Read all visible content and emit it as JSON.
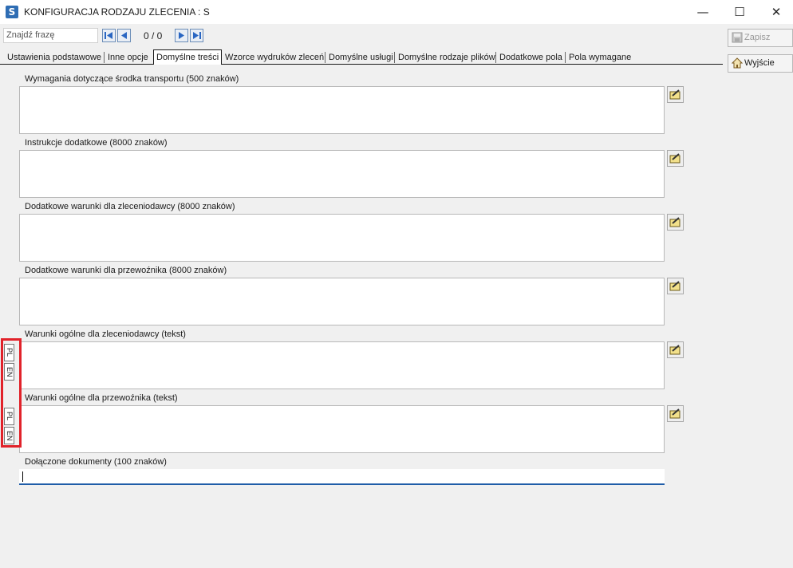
{
  "window": {
    "title": "KONFIGURACJA RODZAJU ZLECENIA : S",
    "app_icon_letter": "S",
    "minimize": "—",
    "maximize": "☐",
    "close": "✕"
  },
  "search": {
    "placeholder": "Znajdź frazę",
    "counter": "0 / 0"
  },
  "actions": {
    "save_label": "Zapisz",
    "exit_label": "Wyjście"
  },
  "tabs": [
    {
      "label": "Ustawienia podstawowe"
    },
    {
      "label": "Inne opcje"
    },
    {
      "label": "Domyślne treści"
    },
    {
      "label": "Wzorce wydruków zleceń"
    },
    {
      "label": "Domyślne usługi"
    },
    {
      "label": "Domyślne rodzaje plików"
    },
    {
      "label": "Dodatkowe pola"
    },
    {
      "label": "Pola wymagane"
    }
  ],
  "active_tab": "Domyślne treści",
  "fields": [
    {
      "label": "Wymagania dotyczące środka transportu (500 znaków)"
    },
    {
      "label": "Instrukcje dodatkowe (8000 znaków)"
    },
    {
      "label": "Dodatkowe warunki dla zleceniodawcy (8000 znaków)"
    },
    {
      "label": "Dodatkowe warunki dla przewoźnika (8000 znaków)"
    },
    {
      "label": "Warunki ogólne dla zleceniodawcy (tekst)"
    },
    {
      "label": "Warunki ogólne dla przewoźnika (tekst)"
    },
    {
      "label": "Dołączone dokumenty (100 znaków)"
    }
  ],
  "language_tabs": {
    "group1": [
      "PL",
      "EN"
    ],
    "group2": [
      "PL",
      "EN"
    ]
  },
  "colors": {
    "highlight": "#e1222a",
    "active_input_underline": "#1f5da8"
  }
}
